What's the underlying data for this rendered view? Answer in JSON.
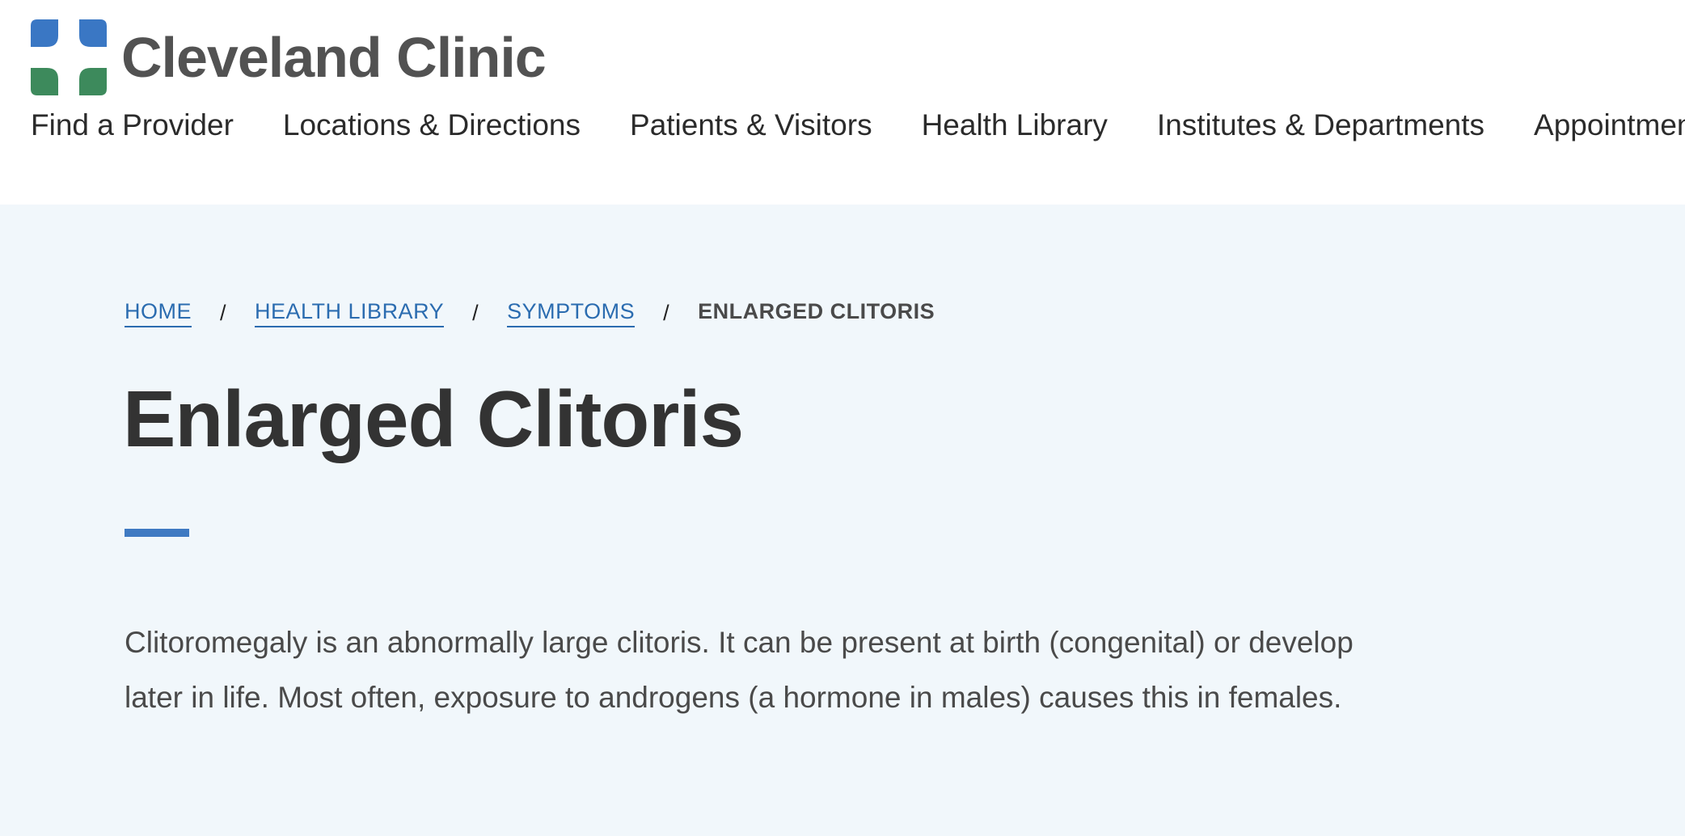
{
  "brand": {
    "name": "Cleveland Clinic",
    "logo_icon": "cleveland-clinic-cross-logo",
    "colors": {
      "blue": "#3a77c4",
      "green": "#3d8a5c"
    }
  },
  "nav": {
    "items": [
      {
        "label": "Find a Provider"
      },
      {
        "label": "Locations & Directions"
      },
      {
        "label": "Patients & Visitors"
      },
      {
        "label": "Health Library"
      },
      {
        "label": "Institutes & Departments"
      },
      {
        "label": "Appointments"
      }
    ]
  },
  "breadcrumb": {
    "items": [
      {
        "label": "HOME"
      },
      {
        "label": "HEALTH LIBRARY"
      },
      {
        "label": "SYMPTOMS"
      }
    ],
    "separator": "/",
    "current": "ENLARGED CLITORIS"
  },
  "page": {
    "title": "Enlarged Clitoris",
    "intro": "Clitoromegaly is an abnormally large clitoris. It can be present at birth (congenital) or develop later in life. Most often, exposure to androgens (a hormone in males) causes this in females."
  },
  "colors": {
    "hero_background": "#f1f7fb",
    "link": "#2b6cb0",
    "accent_rule": "#3f7ac2"
  }
}
